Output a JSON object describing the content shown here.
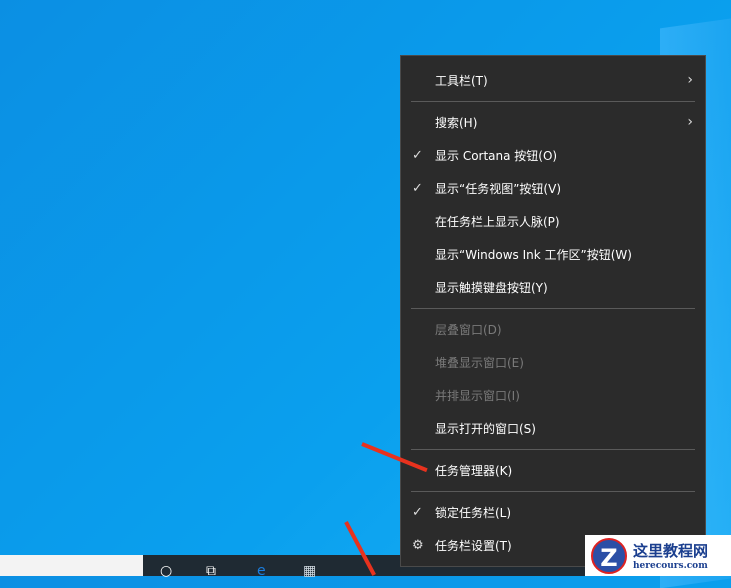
{
  "menu": {
    "items": [
      {
        "label": "工具栏(T)",
        "submenu": true
      },
      {
        "label": "搜索(H)",
        "submenu": true
      },
      {
        "label": "显示 Cortana 按钮(O)",
        "checked": true
      },
      {
        "label": "显示“任务视图”按钮(V)",
        "checked": true
      },
      {
        "label": "在任务栏上显示人脉(P)"
      },
      {
        "label": "显示“Windows Ink 工作区”按钮(W)"
      },
      {
        "label": "显示触摸键盘按钮(Y)"
      },
      {
        "label": "层叠窗口(D)",
        "disabled": true
      },
      {
        "label": "堆叠显示窗口(E)",
        "disabled": true
      },
      {
        "label": "并排显示窗口(I)",
        "disabled": true
      },
      {
        "label": "显示打开的窗口(S)"
      },
      {
        "label": "任务管理器(K)"
      },
      {
        "label": "锁定任务栏(L)",
        "checked": true
      },
      {
        "label": "任务栏设置(T)",
        "icon": "gear-icon"
      }
    ],
    "check_glyph": "✓",
    "arrow_glyph": "›",
    "gear_glyph": "⚙"
  },
  "watermark": {
    "title": "这里教程网",
    "url": "herecours.com",
    "logo": "Z"
  },
  "colors": {
    "menu_bg": "#2b2b2b",
    "annotation_arrow": "#e8321e",
    "taskbar": "#1f2a33"
  }
}
